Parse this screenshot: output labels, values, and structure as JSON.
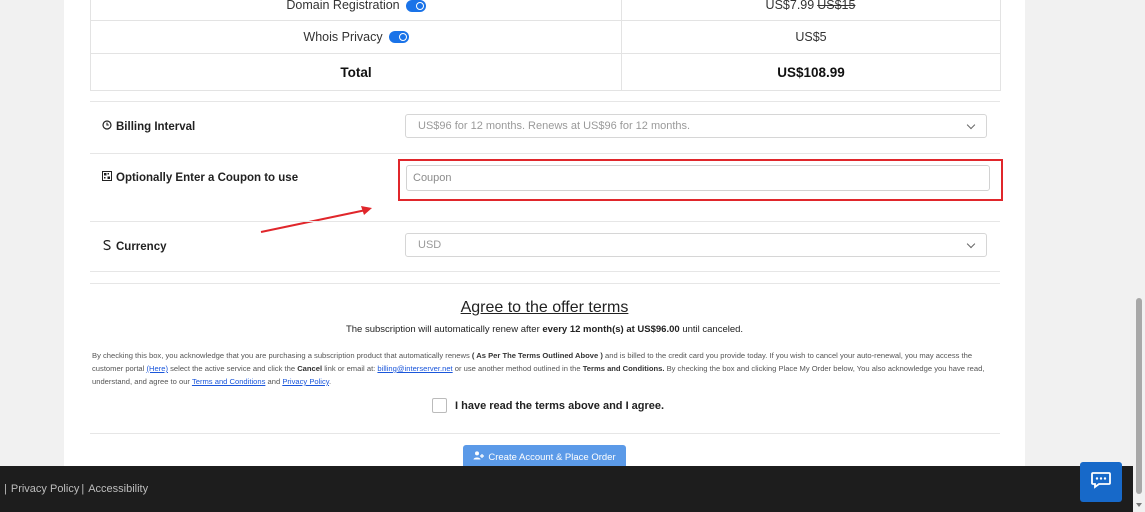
{
  "order": {
    "rows": [
      {
        "label": "Domain Registration",
        "price": "US$7.99",
        "old_price": "US$15"
      },
      {
        "label": "Whois Privacy",
        "price": "US$5"
      }
    ],
    "total_label": "Total",
    "total_value": "US$108.99"
  },
  "billing": {
    "label": "Billing Interval",
    "icon": "clock-icon",
    "selected": "US$96 for 12 months. Renews at US$96 for 12 months."
  },
  "coupon": {
    "label": "Optionally Enter a Coupon to use",
    "icon": "qr-code-icon",
    "placeholder": "Coupon",
    "highlight_color": "#e0262b"
  },
  "currency": {
    "label": "Currency",
    "icon": "dollar-icon",
    "selected": "USD"
  },
  "terms": {
    "title": "Agree to the offer terms",
    "sub_pre": "The subscription will automatically renew after",
    "sub_bold": "every 12 month(s) at US$96.00",
    "sub_post": "until canceled.",
    "legal_1": "By checking this box, you acknowledge that you are purchasing a subscription product that automatically renews",
    "legal_b1": "( As Per The Terms Outlined Above )",
    "legal_2": "and is billed to the credit card you provide today. If you wish to cancel your auto-renewal, you may access the customer portal",
    "legal_link_here": "(Here)",
    "legal_3": "select the active service and click the",
    "legal_b2": "Cancel",
    "legal_4": "link or email at:",
    "legal_email": "billing@interserver.net",
    "legal_5": "or use another method outlined in the",
    "legal_b3": "Terms and Conditions.",
    "legal_6": "By checking the box and clicking Place My Order below, You also acknowledge you have read, understand, and agree to our",
    "legal_link_tc": "Terms and Conditions",
    "legal_and": "and",
    "legal_link_pp": "Privacy Policy",
    "legal_end": ".",
    "checkbox_label": "I have read the terms above and I agree."
  },
  "cta": {
    "label": "Create Account & Place Order",
    "icon": "user-plus-icon"
  },
  "footer": {
    "sep": "|",
    "privacy": "Privacy Policy",
    "pipe": "|",
    "accessibility": "Accessibility"
  },
  "chat": {
    "icon": "chat-icon",
    "color": "#1769c9"
  },
  "colors": {
    "accent": "#1a73e8",
    "annotation": "#e0262b"
  }
}
